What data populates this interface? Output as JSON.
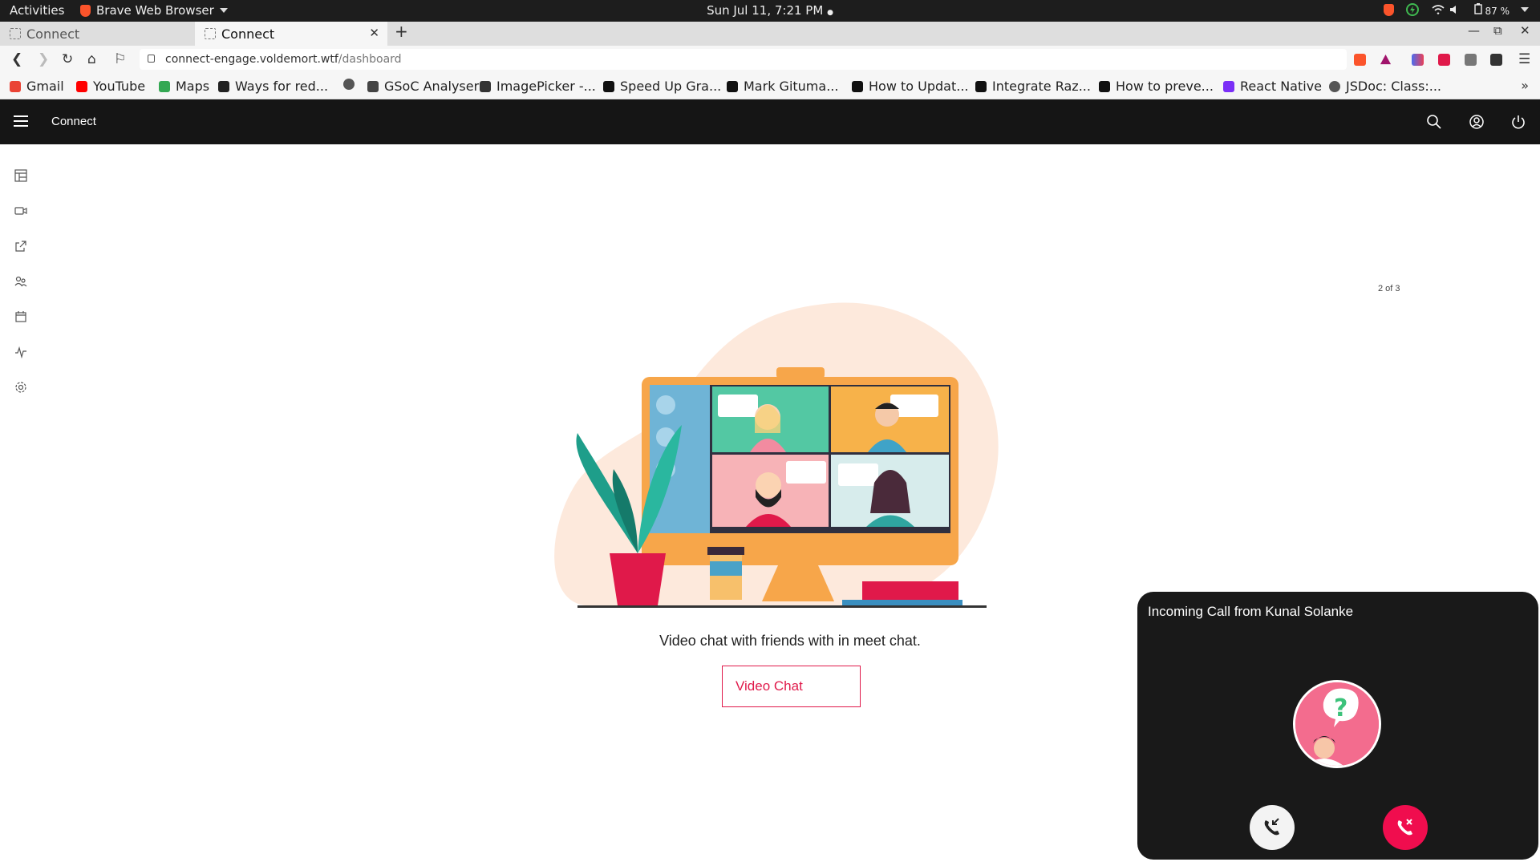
{
  "system": {
    "activities": "Activities",
    "app_name": "Brave Web Browser",
    "clock": "Sun Jul 11,  7:21 PM",
    "battery": "87 %"
  },
  "browser": {
    "tabs": [
      {
        "title": "Connect",
        "active": false
      },
      {
        "title": "Connect",
        "active": true
      }
    ],
    "url_host": "connect-engage.voldemort.wtf",
    "url_path": "/dashboard",
    "bookmarks": [
      {
        "label": "Gmail",
        "icon": "gmail-icon",
        "color": "#ea4335"
      },
      {
        "label": "YouTube",
        "icon": "youtube-icon",
        "color": "#ff0000"
      },
      {
        "label": "Maps",
        "icon": "maps-icon",
        "color": "#34a853"
      },
      {
        "label": "Ways for red...",
        "icon": "site-icon",
        "color": "#222222"
      },
      {
        "label": "",
        "icon": "globe-icon",
        "color": "#555555"
      },
      {
        "label": "GSoC Analyser",
        "icon": "chart-icon",
        "color": "#444444"
      },
      {
        "label": "ImagePicker -...",
        "icon": "github-icon",
        "color": "#333333"
      },
      {
        "label": "Speed Up Gra...",
        "icon": "medium-icon",
        "color": "#111111"
      },
      {
        "label": "Mark Gituma...",
        "icon": "medium-icon",
        "color": "#111111"
      },
      {
        "label": "How to Updat...",
        "icon": "dev-icon",
        "color": "#111111"
      },
      {
        "label": "Integrate Raz...",
        "icon": "dev-icon",
        "color": "#111111"
      },
      {
        "label": "How to preve...",
        "icon": "site-icon",
        "color": "#111111"
      },
      {
        "label": "React Native",
        "icon": "expo-icon",
        "color": "#7b2ff7"
      },
      {
        "label": "JSDoc: Class:...",
        "icon": "globe-icon",
        "color": "#555555"
      }
    ]
  },
  "app": {
    "title": "Connect",
    "sidebar": [
      "dashboard-icon",
      "video-icon",
      "share-screen-icon",
      "contacts-icon",
      "calendar-icon",
      "activity-icon",
      "settings-icon"
    ],
    "carousel_counter": "2 of 3",
    "tagline": "Video chat with friends with in meet chat.",
    "cta_label": "Video Chat"
  },
  "call": {
    "title": "Incoming Call from Kunal Solanke",
    "accept_icon": "phone-incoming-icon",
    "decline_icon": "phone-decline-icon",
    "colors": {
      "accept": "#f3f3f3",
      "decline": "#f00d4e",
      "card": "#191919"
    }
  },
  "theme": {
    "accent": "#e0194a",
    "appbar": "#151515"
  }
}
